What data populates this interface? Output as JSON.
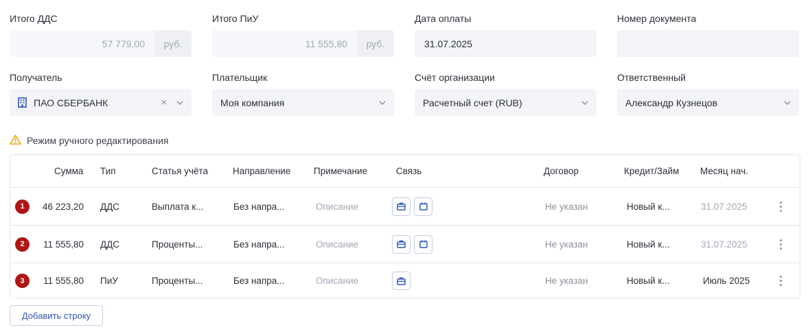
{
  "row1": {
    "dds_total": {
      "label": "Итого ДДС",
      "value": "57 779,00",
      "unit": "руб."
    },
    "piu_total": {
      "label": "Итого ПиУ",
      "value": "11 555,80",
      "unit": "руб."
    },
    "payment_date": {
      "label": "Дата оплаты",
      "value": "31.07.2025"
    },
    "doc_number": {
      "label": "Номер документа",
      "value": ""
    }
  },
  "row2": {
    "recipient": {
      "label": "Получатель",
      "value": "ПАО СБЕРБАНК",
      "clear": "×"
    },
    "payer": {
      "label": "Плательщик",
      "value": "Моя компания"
    },
    "org_account": {
      "label": "Счёт организации",
      "value": "Расчетный счет (RUB)"
    },
    "responsible": {
      "label": "Ответственный",
      "value": "Александр Кузнецов"
    }
  },
  "warning": {
    "text": "Режим ручного редактирования",
    "icon": "warning-icon",
    "color": "#f0a800"
  },
  "table": {
    "headers": {
      "sum": "Сумма",
      "type": "Тип",
      "article": "Статья учёта",
      "direction": "Направление",
      "note": "Примечание",
      "link": "Связь",
      "contract": "Договор",
      "credit": "Кредит/Займ",
      "month": "Месяц нач."
    },
    "rows": [
      {
        "num": "1",
        "sum": "46 223,20",
        "type": "ДДС",
        "article": "Выплата к...",
        "direction": "Без напра...",
        "note": "Описание",
        "contract": "Не указан",
        "credit": "Новый к...",
        "month": "31.07.2025",
        "links": [
          "briefcase-icon",
          "calendar-icon"
        ]
      },
      {
        "num": "2",
        "sum": "11 555,80",
        "type": "ДДС",
        "article": "Проценты...",
        "direction": "Без напра...",
        "note": "Описание",
        "contract": "Не указан",
        "credit": "Новый к...",
        "month": "31.07.2025",
        "links": [
          "briefcase-icon",
          "calendar-icon"
        ]
      },
      {
        "num": "3",
        "sum": "11 555,80",
        "type": "ПиУ",
        "article": "Проценты...",
        "direction": "Без напра...",
        "note": "Описание",
        "contract": "Не указан",
        "credit": "Новый к...",
        "month": "Июль 2025",
        "links": [
          "briefcase-icon"
        ]
      }
    ]
  },
  "add_row_label": "Добавить строку",
  "colors": {
    "badge": "#b01515",
    "accent": "#2f56b8",
    "input_bg": "#f3f4f8",
    "border": "#e3e5ea"
  }
}
